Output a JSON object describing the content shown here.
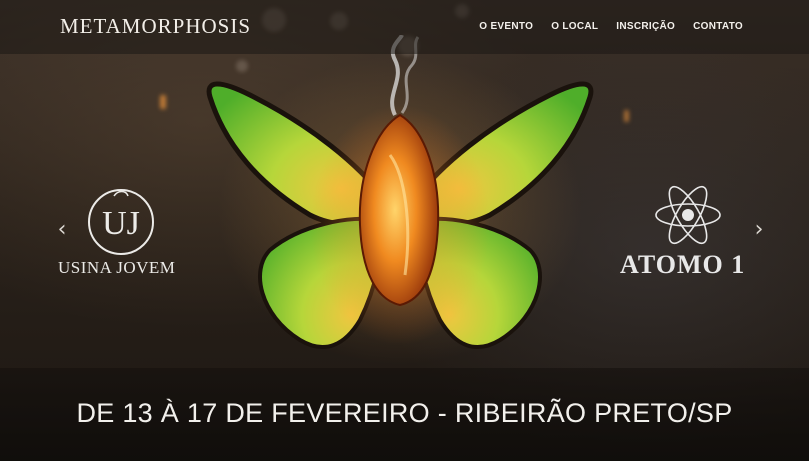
{
  "header": {
    "brand": "METAMORPHOSIS",
    "nav": [
      {
        "label": "O EVENTO"
      },
      {
        "label": "O LOCAL"
      },
      {
        "label": "INSCRIÇÃO"
      },
      {
        "label": "CONTATO"
      }
    ]
  },
  "carousel": {
    "prev_icon": "chevron-left-icon",
    "next_icon": "chevron-right-icon",
    "left_logo": {
      "text": "USINA JOVEM",
      "monogram": "UJ"
    },
    "right_logo": {
      "text": "ATOMO 1"
    }
  },
  "banner": {
    "dates": "DE 13 À 17 DE FEVEREIRO - RIBEIRÃO PRETO/SP"
  },
  "colors": {
    "wing_green": "#7fd13a",
    "wing_yellow": "#e7c64a",
    "chrysalis_orange": "#e36a10",
    "text_light": "#f2f0ec"
  }
}
